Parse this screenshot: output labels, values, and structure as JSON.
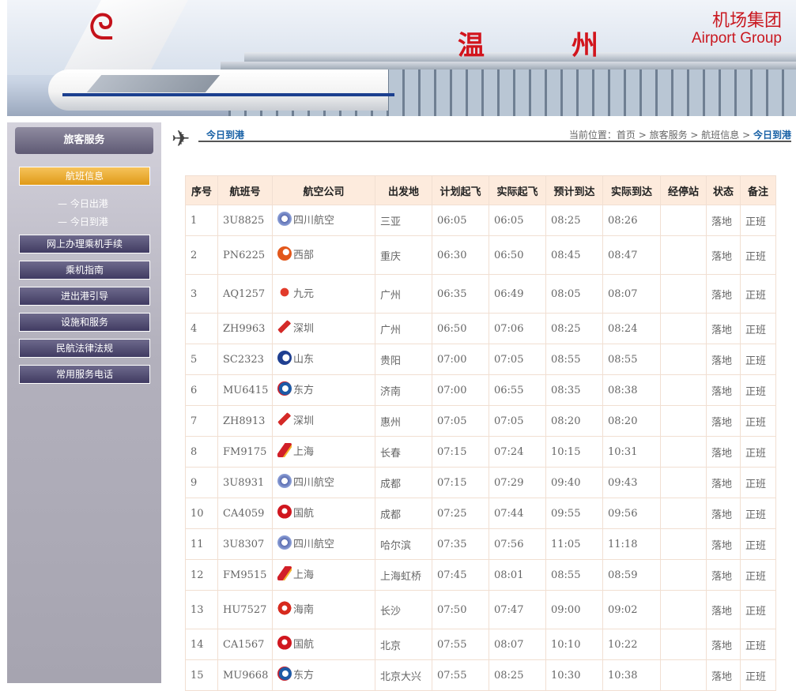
{
  "banner": {
    "city": "温州",
    "group_cn": "机场集团",
    "group_en": "Airport Group"
  },
  "sidebar": {
    "header": "旅客服务",
    "active": "航班信息",
    "subitems": [
      "— 今日出港",
      "— 今日到港"
    ],
    "nav": [
      "网上办理乘机手续",
      "乘机指南",
      "进出港引导",
      "设施和服务",
      "民航法律法规",
      "常用服务电话"
    ]
  },
  "titlebar": {
    "title": "今日到港",
    "crumb_prefix": "当前位置：首页 > 旅客服务 > 航班信息 > ",
    "crumb_current": "今日到港"
  },
  "colors": {
    "accent": "#1760a5",
    "header_bg": "#fdebdd",
    "active_nav": "#e09a18"
  },
  "table": {
    "headers": [
      "序号",
      "航班号",
      "航空公司",
      "出发地",
      "计划起飞",
      "实际起飞",
      "预计到达",
      "实际到达",
      "经停站",
      "状态",
      "备注"
    ],
    "rows": [
      {
        "no": "1",
        "flight": "3U8825",
        "airline": "四川航空",
        "logo": "sichuan-airlines-logo",
        "from": "三亚",
        "plan_dep": "06:05",
        "act_dep": "06:05",
        "est_arr": "08:25",
        "act_arr": "08:26",
        "stop": "",
        "status": "落地",
        "note": "正班"
      },
      {
        "no": "2",
        "flight": "PN6225",
        "airline": "西部",
        "logo": "west-air-logo",
        "from": "重庆",
        "plan_dep": "06:30",
        "act_dep": "06:50",
        "est_arr": "08:45",
        "act_arr": "08:47",
        "stop": "",
        "status": "落地",
        "note": "正班"
      },
      {
        "no": "3",
        "flight": "AQ1257",
        "airline": "九元",
        "logo": "9-air-logo",
        "from": "广州",
        "plan_dep": "06:35",
        "act_dep": "06:49",
        "est_arr": "08:05",
        "act_arr": "08:07",
        "stop": "",
        "status": "落地",
        "note": "正班"
      },
      {
        "no": "4",
        "flight": "ZH9963",
        "airline": "深圳",
        "logo": "shenzhen-airlines-logo",
        "from": "广州",
        "plan_dep": "06:50",
        "act_dep": "07:06",
        "est_arr": "08:25",
        "act_arr": "08:24",
        "stop": "",
        "status": "落地",
        "note": "正班"
      },
      {
        "no": "5",
        "flight": "SC2323",
        "airline": "山东",
        "logo": "shandong-airlines-logo",
        "from": "贵阳",
        "plan_dep": "07:00",
        "act_dep": "07:05",
        "est_arr": "08:55",
        "act_arr": "08:55",
        "stop": "",
        "status": "落地",
        "note": "正班"
      },
      {
        "no": "6",
        "flight": "MU6415",
        "airline": "东方",
        "logo": "china-eastern-logo",
        "from": "济南",
        "plan_dep": "07:00",
        "act_dep": "06:55",
        "est_arr": "08:35",
        "act_arr": "08:38",
        "stop": "",
        "status": "落地",
        "note": "正班"
      },
      {
        "no": "7",
        "flight": "ZH8913",
        "airline": "深圳",
        "logo": "shenzhen-airlines-logo",
        "from": "惠州",
        "plan_dep": "07:05",
        "act_dep": "07:05",
        "est_arr": "08:20",
        "act_arr": "08:20",
        "stop": "",
        "status": "落地",
        "note": "正班"
      },
      {
        "no": "8",
        "flight": "FM9175",
        "airline": "上海",
        "logo": "shanghai-airlines-logo",
        "from": "长春",
        "plan_dep": "07:15",
        "act_dep": "07:24",
        "est_arr": "10:15",
        "act_arr": "10:31",
        "stop": "",
        "status": "落地",
        "note": "正班"
      },
      {
        "no": "9",
        "flight": "3U8931",
        "airline": "四川航空",
        "logo": "sichuan-airlines-logo",
        "from": "成都",
        "plan_dep": "07:15",
        "act_dep": "07:29",
        "est_arr": "09:40",
        "act_arr": "09:43",
        "stop": "",
        "status": "落地",
        "note": "正班"
      },
      {
        "no": "10",
        "flight": "CA4059",
        "airline": "国航",
        "logo": "air-china-logo",
        "from": "成都",
        "plan_dep": "07:25",
        "act_dep": "07:44",
        "est_arr": "09:55",
        "act_arr": "09:56",
        "stop": "",
        "status": "落地",
        "note": "正班"
      },
      {
        "no": "11",
        "flight": "3U8307",
        "airline": "四川航空",
        "logo": "sichuan-airlines-logo",
        "from": "哈尔滨",
        "plan_dep": "07:35",
        "act_dep": "07:56",
        "est_arr": "11:05",
        "act_arr": "11:18",
        "stop": "",
        "status": "落地",
        "note": "正班"
      },
      {
        "no": "12",
        "flight": "FM9515",
        "airline": "上海",
        "logo": "shanghai-airlines-logo",
        "from": "上海虹桥",
        "plan_dep": "07:45",
        "act_dep": "08:01",
        "est_arr": "08:55",
        "act_arr": "08:59",
        "stop": "",
        "status": "落地",
        "note": "正班"
      },
      {
        "no": "13",
        "flight": "HU7527",
        "airline": "海南",
        "logo": "hainan-airlines-logo",
        "from": "长沙",
        "plan_dep": "07:50",
        "act_dep": "07:47",
        "est_arr": "09:00",
        "act_arr": "09:02",
        "stop": "",
        "status": "落地",
        "note": "正班"
      },
      {
        "no": "14",
        "flight": "CA1567",
        "airline": "国航",
        "logo": "air-china-logo",
        "from": "北京",
        "plan_dep": "07:55",
        "act_dep": "08:07",
        "est_arr": "10:10",
        "act_arr": "10:22",
        "stop": "",
        "status": "落地",
        "note": "正班"
      },
      {
        "no": "15",
        "flight": "MU9668",
        "airline": "东方",
        "logo": "china-eastern-logo",
        "from": "北京大兴",
        "plan_dep": "07:55",
        "act_dep": "08:25",
        "est_arr": "10:30",
        "act_arr": "10:38",
        "stop": "",
        "status": "落地",
        "note": "正班"
      }
    ]
  }
}
